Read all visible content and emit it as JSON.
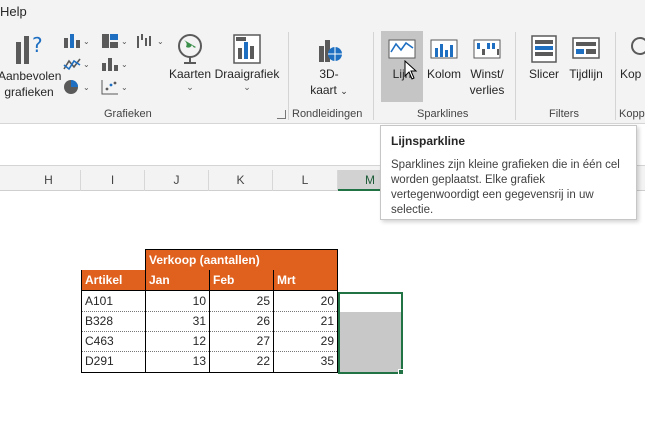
{
  "menu": {
    "help": "Help"
  },
  "ribbon": {
    "groups": {
      "grafieken": "Grafieken",
      "rondleidingen": "Rondleidingen",
      "sparklines": "Sparklines",
      "filters": "Filters",
      "kopp": "Kopp"
    },
    "buttons": {
      "aanbevolen_line1": "Aanbevolen",
      "aanbevolen_line2": "grafieken",
      "kaarten": "Kaarten",
      "draaigrafiek": "Draaigrafiek",
      "kaart3d_line1": "3D-",
      "kaart3d_line2": "kaart",
      "lijn": "Lijn",
      "kolom": "Kolom",
      "winst_line1": "Winst/",
      "winst_line2": "verlies",
      "slicer": "Slicer",
      "tijdlijn": "Tijdlijn",
      "kopp": "Kop"
    }
  },
  "tooltip": {
    "title": "Lijnsparkline",
    "body": "Sparklines zijn kleine grafieken die in één cel worden geplaatst. Elke grafiek vertegenwoordigt een gegevensrij in uw selectie."
  },
  "columns": [
    "H",
    "I",
    "J",
    "K",
    "L",
    "M"
  ],
  "table": {
    "group_header": "Verkoop (aantallen)",
    "headers": [
      "Artikel",
      "Jan",
      "Feb",
      "Mrt"
    ],
    "rows": [
      [
        "A101",
        "10",
        "25",
        "20"
      ],
      [
        "B328",
        "31",
        "26",
        "21"
      ],
      [
        "C463",
        "12",
        "27",
        "29"
      ],
      [
        "D291",
        "13",
        "22",
        "35"
      ]
    ]
  },
  "colors": {
    "accent_green": "#217346",
    "table_orange": "#e0611e"
  }
}
